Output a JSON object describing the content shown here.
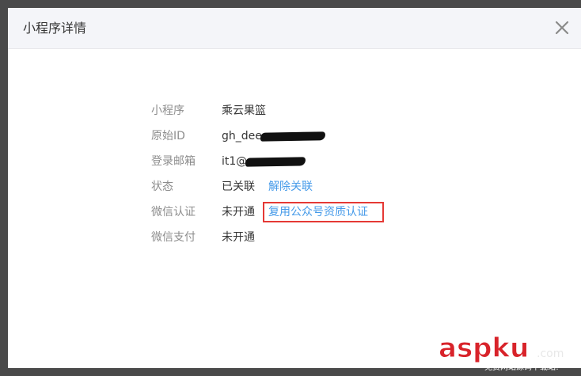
{
  "dialog": {
    "title": "小程序详情"
  },
  "details": {
    "mini_program": {
      "label": "小程序",
      "value": "乘云果篮"
    },
    "original_id": {
      "label": "原始ID",
      "value": "gh_dee"
    },
    "login_email": {
      "label": "登录邮箱",
      "value": "it1@"
    },
    "status": {
      "label": "状态",
      "value": "已关联",
      "action": "解除关联"
    },
    "wechat_auth": {
      "label": "微信认证",
      "value": "未开通",
      "action": "复用公众号资质认证"
    },
    "wechat_pay": {
      "label": "微信支付",
      "value": "未开通"
    }
  },
  "watermark": {
    "brand": "aspku",
    "suffix": ".com",
    "tagline": "免费网站源码下载站!"
  },
  "colors": {
    "overlay": "#4a4a4a",
    "header_bg": "#f4f5f9",
    "label": "#8d8d8d",
    "value": "#353535",
    "link": "#459ae9",
    "highlight": "#e53935",
    "watermark_brand": "#d8232a"
  },
  "icons": {
    "close": "close-icon"
  }
}
